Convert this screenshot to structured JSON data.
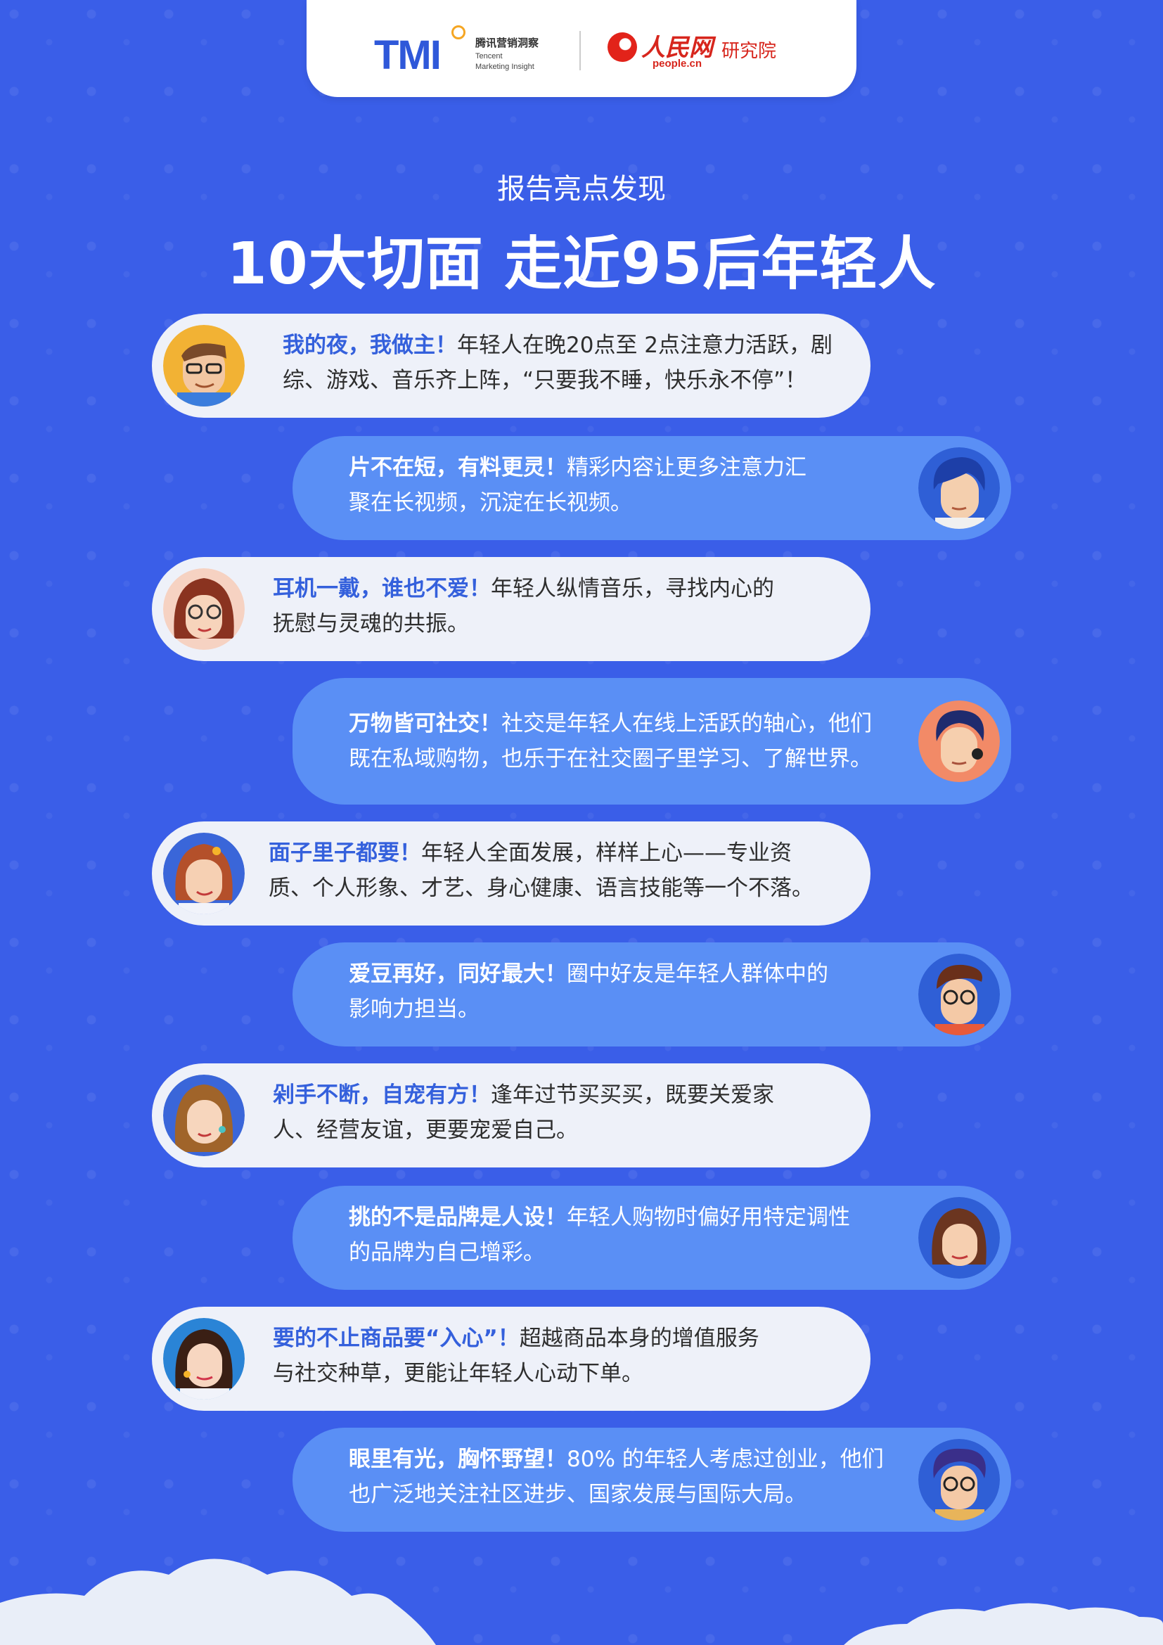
{
  "header": {
    "tmi_logo": "TMI",
    "tmi_cn": "腾讯营销洞察",
    "tmi_en_line1": "Tencent",
    "tmi_en_line2": "Marketing Insight",
    "people_cn": "人民网",
    "people_url": "people.cn",
    "people_inst": "研究院"
  },
  "subtitle": "报告亮点发现",
  "title": "10大切面 走近95后年轻人",
  "items": [
    {
      "highlight": "我的夜，我做主！",
      "line1": "年轻人在晚20点至 2点注意力活跃，剧",
      "line2": "综、游戏、音乐齐上阵，“只要我不睡，快乐永不停”！",
      "avatar": "glasses-man-icon"
    },
    {
      "highlight": "片不在短，有料更灵！",
      "line1": "精彩内容让更多注意力汇",
      "line2": "聚在长视频，沉淀在长视频。",
      "avatar": "blue-hair-boy-icon"
    },
    {
      "highlight": "耳机一戴，谁也不爱！",
      "line1": "年轻人纵情音乐，寻找内心的",
      "line2": "抚慰与灵魂的共振。",
      "avatar": "headphones-girl-icon"
    },
    {
      "highlight": "万物皆可社交！",
      "line1": "社交是年轻人在线上活跃的轴心，他们",
      "line2": "既在私域购物，也乐于在社交圈子里学习、了解世界。",
      "avatar": "headset-boy-icon"
    },
    {
      "highlight": "面子里子都要！",
      "line1": "年轻人全面发展，样样上心——专业资",
      "line2": "质、个人形象、才艺、身心健康、语言技能等一个不落。",
      "avatar": "redhead-girl-icon"
    },
    {
      "highlight": "爱豆再好，同好最大！",
      "line1": "圈中好友是年轻人群体中的",
      "line2": "影响力担当。",
      "avatar": "glasses-boy-icon"
    },
    {
      "highlight": "剁手不断，自宠有方！",
      "line1": "逢年过节买买买，既要关爱家",
      "line2": "人、经营友谊，更要宠爱自己。",
      "avatar": "blonde-girl-icon"
    },
    {
      "highlight": "挑的不是品牌是人设！",
      "line1": "年轻人购物时偏好用特定调性",
      "line2": "的品牌为自己增彩。",
      "avatar": "brown-hair-girl-icon"
    },
    {
      "highlight": "要的不止商品要“入心”！",
      "line1": "超越商品本身的增值服务",
      "line2": "与社交种草，更能让年轻人心动下单。",
      "avatar": "earring-girl-icon"
    },
    {
      "highlight": "眼里有光，胸怀野望！",
      "line1": "80% 的年轻人考虑过创业，他们",
      "line2": "也广泛地关注社区进步、国家发展与国际大局。",
      "avatar": "curly-hair-boy-icon"
    }
  ]
}
